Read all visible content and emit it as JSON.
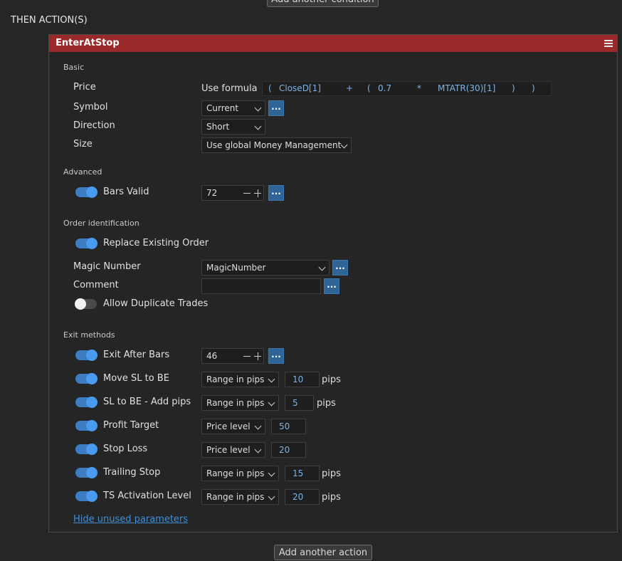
{
  "top_button": "Add another condition",
  "section_title": "THEN ACTION(S)",
  "panel": {
    "title": "EnterAtStop",
    "header_color": "#9a2a2a"
  },
  "basic": {
    "label": "Basic",
    "price_label": "Price",
    "price_mode": "Use formula",
    "formula_tokens": [
      "(",
      "CloseD[1]",
      "+",
      "(",
      "0.7",
      "*",
      "MTATR(30)[1]",
      ")",
      ")"
    ],
    "symbol_label": "Symbol",
    "symbol_value": "Current",
    "direction_label": "Direction",
    "direction_value": "Short",
    "size_label": "Size",
    "size_value": "Use global Money Management"
  },
  "advanced": {
    "label": "Advanced",
    "bars_valid_label": "Bars Valid",
    "bars_valid_enabled": true,
    "bars_valid_value": "72"
  },
  "order_identification": {
    "label": "Order identification",
    "replace_existing_label": "Replace Existing Order",
    "replace_existing_enabled": true,
    "magic_number_label": "Magic Number",
    "magic_number_value": "MagicNumber",
    "comment_label": "Comment",
    "comment_value": "",
    "allow_duplicate_label": "Allow Duplicate Trades",
    "allow_duplicate_enabled": false
  },
  "exit_methods": {
    "label": "Exit methods",
    "exit_after_bars_label": "Exit After Bars",
    "exit_after_bars_value": "46",
    "move_sl_be_label": "Move SL to BE",
    "move_sl_be_mode": "Range in pips",
    "move_sl_be_value": "10",
    "sl_be_add_label": "SL to BE - Add pips",
    "sl_be_add_mode": "Range in pips",
    "sl_be_add_value": "5",
    "profit_target_label": "Profit Target",
    "profit_target_mode": "Price level",
    "profit_target_value": "50",
    "stop_loss_label": "Stop Loss",
    "stop_loss_mode": "Price level",
    "stop_loss_value": "20",
    "trailing_stop_label": "Trailing Stop",
    "trailing_stop_mode": "Range in pips",
    "trailing_stop_value": "15",
    "ts_activation_label": "TS Activation Level",
    "ts_activation_mode": "Range in pips",
    "ts_activation_value": "20",
    "pips_unit": "pips"
  },
  "dots_label": "...",
  "hide_unused_link": "Hide unused parameters",
  "bottom_button": "Add another action",
  "icons": {
    "menu": "hamburger-menu-icon",
    "dropdown": "chevron-down-icon",
    "stepper_minus": "minus-icon",
    "stepper_plus": "plus-icon"
  },
  "colors": {
    "background": "#262626",
    "accent_blue": "#3c7dc4",
    "value_blue": "#7fb3e6",
    "link_blue": "#3f8fd8"
  }
}
